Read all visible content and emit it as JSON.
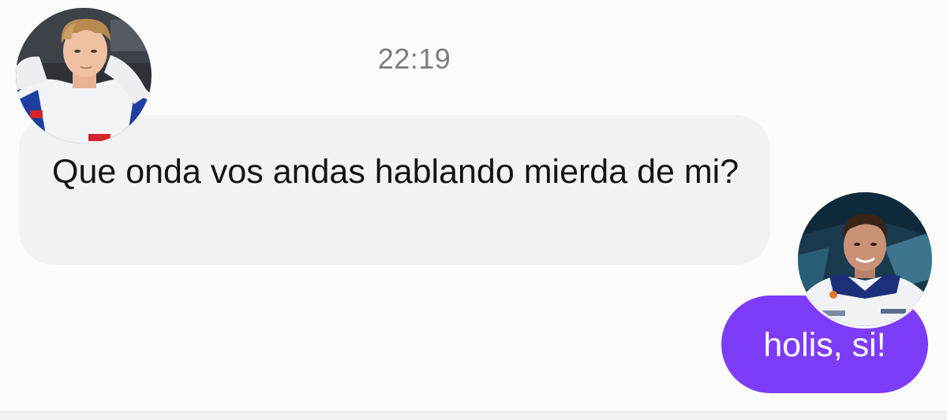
{
  "conversation": {
    "timestamp": "22:19",
    "messages": [
      {
        "direction": "incoming",
        "text": "Que onda vos andas hablando mierda de mi?",
        "avatar_icon": "incoming-contact-avatar"
      },
      {
        "direction": "outgoing",
        "text": "holis, si!",
        "avatar_icon": "outgoing-contact-avatar"
      }
    ]
  },
  "colors": {
    "background": "#fbfbfc",
    "incoming_bubble": "#f1f2f4",
    "outgoing_bubble": "#7d3cf8",
    "timestamp_text": "#7b7d82"
  }
}
